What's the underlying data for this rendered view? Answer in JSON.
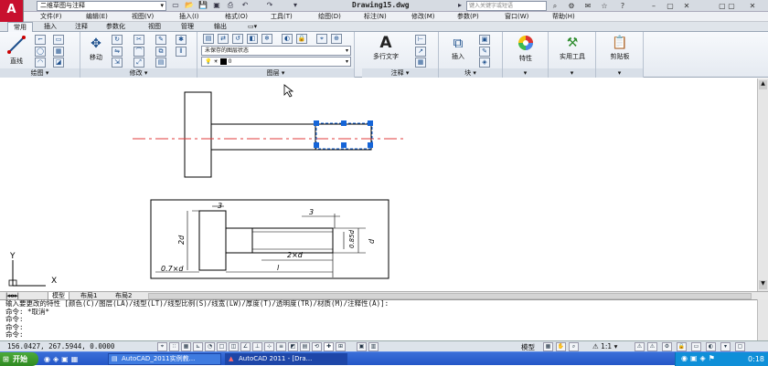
{
  "titlebar": {
    "workspace": "二维草图与注释",
    "document_title": "Drawing15.dwg",
    "search_placeholder": "键入关键字或短语"
  },
  "menubar": {
    "items": [
      "文件(F)",
      "编辑(E)",
      "视图(V)",
      "插入(I)",
      "格式(O)",
      "工具(T)",
      "绘图(D)",
      "标注(N)",
      "修改(M)",
      "参数(P)",
      "窗口(W)",
      "帮助(H)"
    ]
  },
  "ribbon_tabs": [
    "常用",
    "插入",
    "注释",
    "参数化",
    "视图",
    "管理",
    "输出"
  ],
  "ribbon": {
    "draw": {
      "title": "绘图",
      "line_label": "直线"
    },
    "modify": {
      "title": "修改",
      "move_label": "移动"
    },
    "layers": {
      "title": "图层",
      "layer_state": "未保存的图层状态",
      "current_layer": "0"
    },
    "annotation": {
      "title": "注释",
      "mtext_label": "多行文字"
    },
    "block": {
      "title": "块",
      "insert_label": "插入"
    },
    "properties": {
      "label": "特性"
    },
    "utilities": {
      "label": "实用工具"
    },
    "clipboard": {
      "label": "剪贴板"
    }
  },
  "drawing": {
    "dim_top": "3",
    "dim_shaft": "3",
    "dim_2d": "2d",
    "dim_2xd": "2×d",
    "dim_085d": "0.85d",
    "dim_d": "d",
    "dim_07d": "0.7×d",
    "dim_l": "l",
    "ucs_x": "X",
    "ucs_y": "Y"
  },
  "layout_tabs": [
    "模型",
    "布局1",
    "布局2"
  ],
  "command": {
    "lines": [
      "输入要更改的特性 [颜色(C)/图层(LA)/线型(LT)/线型比例(S)/线宽(LW)/厚度(T)/透明度(TR)/材质(M)/注释性(A)]:",
      "命令: *取消*",
      "命令:",
      "命令:",
      "命令:"
    ]
  },
  "statusbar": {
    "coordinates": "156.0427, 267.5944, 0.0000",
    "model_label": "模型",
    "scale": "1:1"
  },
  "taskbar": {
    "start_label": "开始",
    "tasks": [
      "AutoCAD_2011实例教...",
      "AutoCAD 2011 - [Dra..."
    ],
    "clock": "0:18"
  },
  "colors": {
    "title_bg": "#d6dbe2",
    "accent_red": "#c8102e",
    "grip_blue": "#1565d8",
    "centerline_red": "#e23b3b",
    "taskbar_blue": "#2456c7"
  }
}
